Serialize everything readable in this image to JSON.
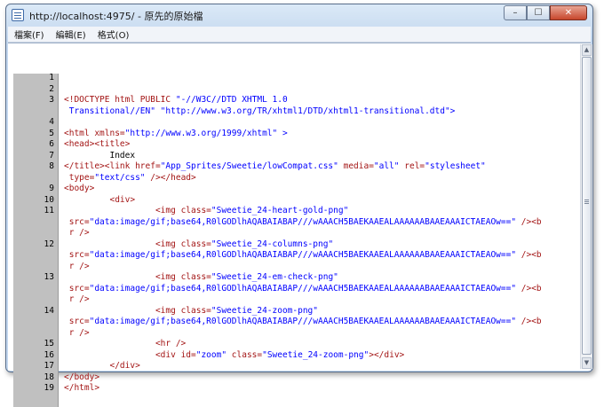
{
  "window": {
    "title": "http://localhost:4975/ - 原先的原始檔",
    "icon": "notepad-icon",
    "caption_buttons": {
      "minimize": "–",
      "maximize": "☐",
      "close": "✕"
    }
  },
  "menu": [
    "檔案(F)",
    "編輯(E)",
    "格式(O)"
  ],
  "lines": [
    {
      "num": "1",
      "segments": []
    },
    {
      "num": "2",
      "segments": []
    },
    {
      "num": "3",
      "segments": [
        {
          "t": "<!DOCTYPE html PUBLIC ",
          "c": "tag"
        },
        {
          "t": "\"-//W3C//DTD XHTML 1.0",
          "c": "str"
        }
      ]
    },
    {
      "num": "",
      "segments": [
        {
          "t": " Transitional//EN\" \"http://www.w3.org/TR/xhtml1/DTD/xhtml1-transitional.dtd\">",
          "c": "str"
        }
      ]
    },
    {
      "num": "4",
      "segments": []
    },
    {
      "num": "5",
      "segments": [
        {
          "t": "<html ",
          "c": "tag"
        },
        {
          "t": "xmlns=",
          "c": "tag"
        },
        {
          "t": "\"http://www.w3.org/1999/xhtml\" >",
          "c": "str"
        }
      ]
    },
    {
      "num": "6",
      "segments": [
        {
          "t": "<head><title>",
          "c": "tag"
        }
      ]
    },
    {
      "num": "7",
      "segments": [
        {
          "t": "         Index",
          "c": "txt"
        }
      ]
    },
    {
      "num": "8",
      "segments": [
        {
          "t": "</title><link ",
          "c": "tag"
        },
        {
          "t": "href=",
          "c": "tag"
        },
        {
          "t": "\"App_Sprites/Sweetie/lowCompat.css\" ",
          "c": "str"
        },
        {
          "t": "media=",
          "c": "tag"
        },
        {
          "t": "\"all\" ",
          "c": "str"
        },
        {
          "t": "rel=",
          "c": "tag"
        },
        {
          "t": "\"stylesheet\"",
          "c": "str"
        }
      ]
    },
    {
      "num": "",
      "segments": [
        {
          "t": " type=",
          "c": "tag"
        },
        {
          "t": "\"text/css\" ",
          "c": "str"
        },
        {
          "t": "/></head>",
          "c": "tag"
        }
      ]
    },
    {
      "num": "9",
      "segments": [
        {
          "t": "<body>",
          "c": "tag"
        }
      ]
    },
    {
      "num": "10",
      "segments": [
        {
          "t": "         <div>",
          "c": "tag"
        }
      ]
    },
    {
      "num": "11",
      "segments": [
        {
          "t": "                  <img ",
          "c": "tag"
        },
        {
          "t": "class=",
          "c": "tag"
        },
        {
          "t": "\"Sweetie_24-heart-gold-png\"",
          "c": "str"
        }
      ]
    },
    {
      "num": "",
      "segments": [
        {
          "t": " src=",
          "c": "tag"
        },
        {
          "t": "\"data:image/gif;base64,R0lGODlhAQABAIABAP///wAAACH5BAEKAAEALAAAAAABAAEAAAICTAEAOw==\" ",
          "c": "str"
        },
        {
          "t": "/><b",
          "c": "tag"
        }
      ]
    },
    {
      "num": "",
      "segments": [
        {
          "t": " r />",
          "c": "tag"
        }
      ]
    },
    {
      "num": "12",
      "segments": [
        {
          "t": "                  <img ",
          "c": "tag"
        },
        {
          "t": "class=",
          "c": "tag"
        },
        {
          "t": "\"Sweetie_24-columns-png\"",
          "c": "str"
        }
      ]
    },
    {
      "num": "",
      "segments": [
        {
          "t": " src=",
          "c": "tag"
        },
        {
          "t": "\"data:image/gif;base64,R0lGODlhAQABAIABAP///wAAACH5BAEKAAEALAAAAAABAAEAAAICTAEAOw==\" ",
          "c": "str"
        },
        {
          "t": "/><b",
          "c": "tag"
        }
      ]
    },
    {
      "num": "",
      "segments": [
        {
          "t": " r />",
          "c": "tag"
        }
      ]
    },
    {
      "num": "13",
      "segments": [
        {
          "t": "                  <img ",
          "c": "tag"
        },
        {
          "t": "class=",
          "c": "tag"
        },
        {
          "t": "\"Sweetie_24-em-check-png\"",
          "c": "str"
        }
      ]
    },
    {
      "num": "",
      "segments": [
        {
          "t": " src=",
          "c": "tag"
        },
        {
          "t": "\"data:image/gif;base64,R0lGODlhAQABAIABAP///wAAACH5BAEKAAEALAAAAAABAAEAAAICTAEAOw==\" ",
          "c": "str"
        },
        {
          "t": "/><b",
          "c": "tag"
        }
      ]
    },
    {
      "num": "",
      "segments": [
        {
          "t": " r />",
          "c": "tag"
        }
      ]
    },
    {
      "num": "14",
      "segments": [
        {
          "t": "                  <img ",
          "c": "tag"
        },
        {
          "t": "class=",
          "c": "tag"
        },
        {
          "t": "\"Sweetie_24-zoom-png\"",
          "c": "str"
        }
      ]
    },
    {
      "num": "",
      "segments": [
        {
          "t": " src=",
          "c": "tag"
        },
        {
          "t": "\"data:image/gif;base64,R0lGODlhAQABAIABAP///wAAACH5BAEKAAEALAAAAAABAAEAAAICTAEAOw==\" ",
          "c": "str"
        },
        {
          "t": "/><b",
          "c": "tag"
        }
      ]
    },
    {
      "num": "",
      "segments": [
        {
          "t": " r />",
          "c": "tag"
        }
      ]
    },
    {
      "num": "15",
      "segments": [
        {
          "t": "                  <hr />",
          "c": "tag"
        }
      ]
    },
    {
      "num": "16",
      "segments": [
        {
          "t": "                  <div ",
          "c": "tag"
        },
        {
          "t": "id=",
          "c": "tag"
        },
        {
          "t": "\"zoom\" ",
          "c": "str"
        },
        {
          "t": "class=",
          "c": "tag"
        },
        {
          "t": "\"Sweetie_24-zoom-png\"",
          "c": "str"
        },
        {
          "t": "></div>",
          "c": "tag"
        }
      ]
    },
    {
      "num": "17",
      "segments": [
        {
          "t": "         </div>",
          "c": "tag"
        }
      ]
    },
    {
      "num": "18",
      "segments": [
        {
          "t": "</body>",
          "c": "tag"
        }
      ]
    },
    {
      "num": "19",
      "segments": [
        {
          "t": "</html>",
          "c": "tag"
        }
      ]
    }
  ],
  "colors": {
    "tag": "#a31515",
    "attr": "#ff0000",
    "string": "#0000ff",
    "gutter": "#c0c0c0"
  }
}
